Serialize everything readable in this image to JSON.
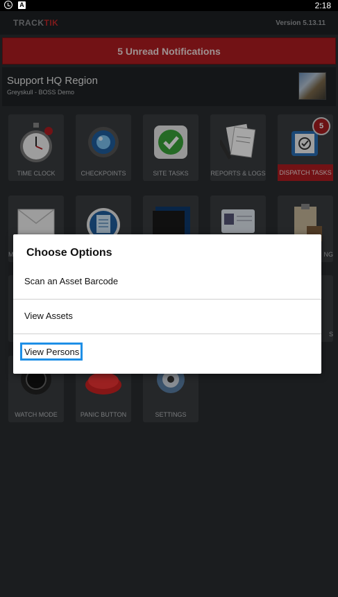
{
  "status_bar": {
    "time": "2:18",
    "icons": [
      "clock-icon",
      "a-badge-icon"
    ],
    "a_glyph": "A"
  },
  "header": {
    "logo_track": "TRACK",
    "logo_tik": "TIK",
    "version": "Version 5.13.11"
  },
  "notification_banner": {
    "text": "5 Unread Notifications"
  },
  "region": {
    "title": "Support HQ Region",
    "subtitle": "Greyskull - BOSS Demo"
  },
  "tiles": [
    {
      "label": "TIME CLOCK",
      "icon": "stopwatch-icon"
    },
    {
      "label": "CHECKPOINTS",
      "icon": "checkpoint-icon"
    },
    {
      "label": "SITE TASKS",
      "icon": "checkmark-icon"
    },
    {
      "label": "REPORTS & LOGS",
      "icon": "reports-icon"
    },
    {
      "label": "DISPATCH TASKS",
      "icon": "dispatch-icon",
      "badge": "5"
    },
    {
      "label": "M",
      "icon": "envelope-icon"
    },
    {
      "label": "",
      "icon": "document-icon"
    },
    {
      "label": "",
      "icon": "folder-icon"
    },
    {
      "label": "",
      "icon": "id-badge-icon"
    },
    {
      "label": "NG",
      "icon": "clipboard-icon"
    },
    {
      "label": "S",
      "icon": "generic-icon"
    },
    {
      "label": "WATCH MODE",
      "icon": "camera-lens-icon"
    },
    {
      "label": "PANIC BUTTON",
      "icon": "panic-button-icon"
    },
    {
      "label": "SETTINGS",
      "icon": "settings-icon"
    }
  ],
  "dialog": {
    "title": "Choose Options",
    "options": [
      {
        "label": "Scan an Asset Barcode"
      },
      {
        "label": "View Assets"
      },
      {
        "label": "View Persons"
      }
    ]
  },
  "colors": {
    "accent_red": "#b01d21",
    "focus_blue": "#1e8fe6",
    "background": "#2a2d30"
  }
}
